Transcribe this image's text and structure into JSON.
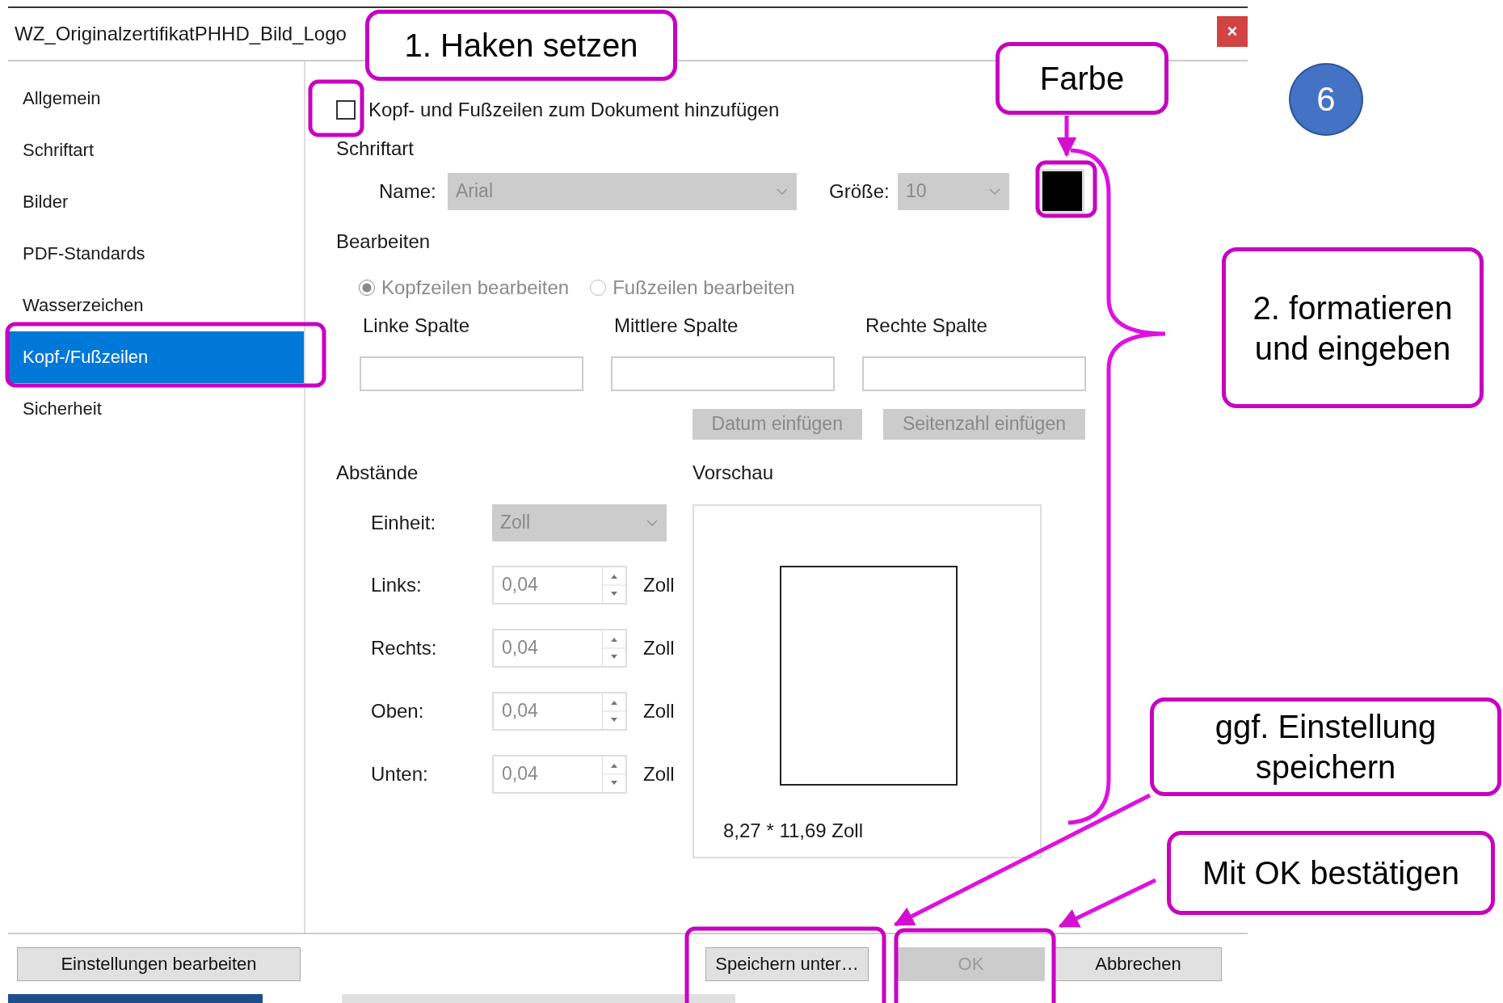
{
  "window": {
    "title": "WZ_OriginalzertifikatPHHD_Bild_Logo",
    "close_button": "×"
  },
  "sidebar": {
    "items": [
      {
        "label": "Allgemein",
        "selected": false
      },
      {
        "label": "Schriftart",
        "selected": false
      },
      {
        "label": "Bilder",
        "selected": false
      },
      {
        "label": "PDF-Standards",
        "selected": false
      },
      {
        "label": "Wasserzeichen",
        "selected": false
      },
      {
        "label": "Kopf-/Fußzeilen",
        "selected": true
      },
      {
        "label": "Sicherheit",
        "selected": false
      }
    ]
  },
  "add_checkbox": {
    "label": "Kopf- und Fußzeilen zum Dokument hinzufügen",
    "checked": false
  },
  "font_section": {
    "heading": "Schriftart",
    "name_label": "Name:",
    "name_value": "Arial",
    "size_label": "Größe:",
    "size_value": "10",
    "color": "#000000",
    "disabled": true
  },
  "edit_section": {
    "heading": "Bearbeiten",
    "disabled": true,
    "radios": [
      {
        "label": "Kopfzeilen bearbeiten",
        "selected": true
      },
      {
        "label": "Fußzeilen bearbeiten",
        "selected": false
      }
    ],
    "columns": [
      {
        "label": "Linke Spalte"
      },
      {
        "label": "Mittlere Spalte"
      },
      {
        "label": "Rechte Spalte"
      }
    ],
    "buttons": [
      "Datum einfügen",
      "Seitenzahl einfügen"
    ]
  },
  "margins": {
    "heading": "Abstände",
    "disabled": true,
    "unit_label": "Einheit:",
    "unit_value": "Zoll",
    "fields": [
      {
        "label": "Links:",
        "value": "0,04",
        "unit": "Zoll"
      },
      {
        "label": "Rechts:",
        "value": "0,04",
        "unit": "Zoll"
      },
      {
        "label": "Oben:",
        "value": "0,04",
        "unit": "Zoll"
      },
      {
        "label": "Unten:",
        "value": "0,04",
        "unit": "Zoll"
      }
    ]
  },
  "preview": {
    "heading": "Vorschau",
    "page_size": "8,27 * 11,69 Zoll"
  },
  "footer_buttons": [
    {
      "label": "Einstellungen bearbeiten",
      "disabled": false
    },
    {
      "label": "Speichern unter…",
      "disabled": false
    },
    {
      "label": "OK",
      "disabled": true
    },
    {
      "label": "Abbrechen",
      "disabled": false
    }
  ],
  "annotations": {
    "step_badge": "6",
    "callouts": [
      {
        "text": "1. Haken setzen"
      },
      {
        "text": "Farbe"
      },
      {
        "text": "2. formatieren\nund eingeben"
      },
      {
        "text": "ggf. Einstellung\nspeichern"
      },
      {
        "text": "Mit OK bestätigen"
      }
    ]
  }
}
